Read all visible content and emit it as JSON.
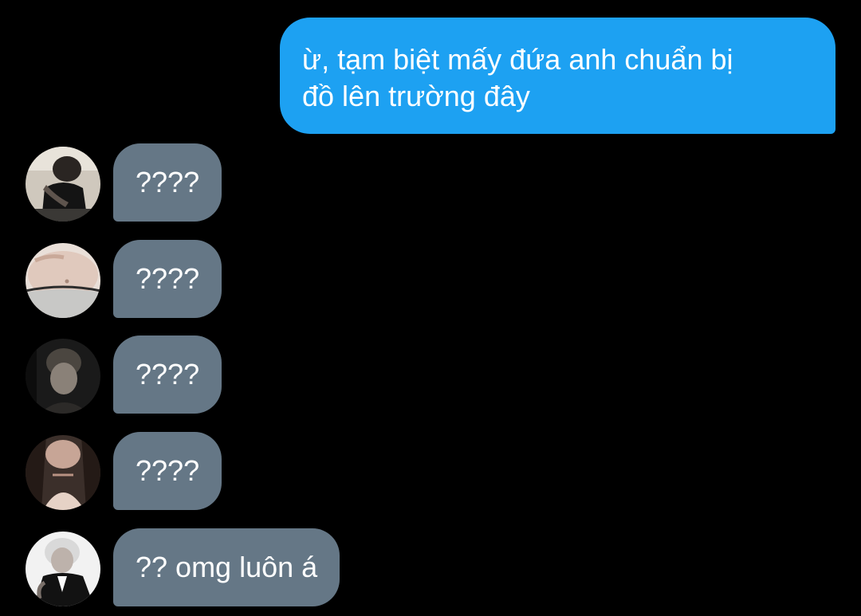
{
  "outgoing_message": {
    "line1": "ừ, tạm biệt mấy đứa anh chuẩn bị",
    "line2": "đồ lên trường đây",
    "color": "#1da1f2"
  },
  "incoming_messages": [
    {
      "text": "????",
      "avatar": "avatar-person-tattoo-arm"
    },
    {
      "text": "????",
      "avatar": "avatar-waist-photo"
    },
    {
      "text": "????",
      "avatar": "avatar-dark-hair-portrait"
    },
    {
      "text": "????",
      "avatar": "avatar-long-hair-portrait"
    },
    {
      "text": "?? omg luôn á",
      "avatar": "avatar-suit-portrait"
    }
  ],
  "colors": {
    "background": "#000000",
    "incoming_bubble": "#657786",
    "text": "#ffffff"
  }
}
